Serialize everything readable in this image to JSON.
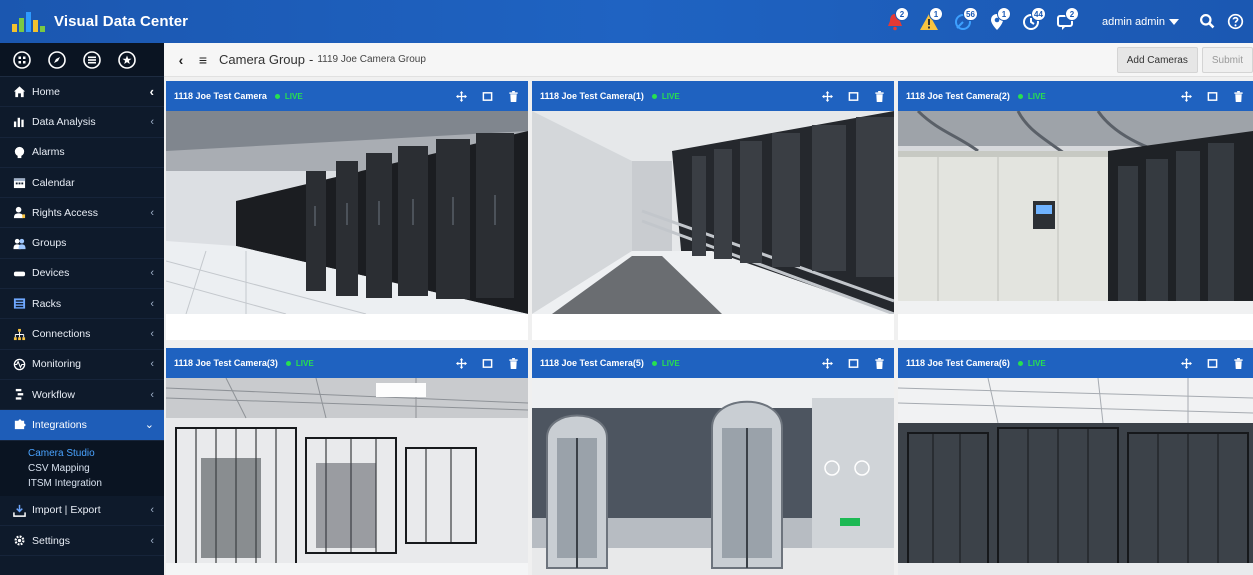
{
  "app": {
    "title": "Visual Data Center"
  },
  "brand": {
    "logo_colors": [
      "#f2c12e",
      "#7ac943",
      "#2e9bff",
      "#f2c12e",
      "#7ac943"
    ]
  },
  "colors": {
    "topbar": "#1f62c0",
    "sidebar": "#0e1a2b",
    "active_nav": "#1e5db8",
    "live": "#27e050",
    "link": "#4aa3ff"
  },
  "notifications": [
    {
      "icon": "alert-bell-icon",
      "count": "2",
      "color": "#e53935"
    },
    {
      "icon": "warning-icon",
      "count": "1",
      "color": "#f9c440"
    },
    {
      "icon": "satellite-icon",
      "count": "56",
      "color": "#3da0ff"
    },
    {
      "icon": "location-pin-icon",
      "count": "1",
      "color": "#ffffff"
    },
    {
      "icon": "refresh-clock-icon",
      "count": "44",
      "color": "#ffffff"
    },
    {
      "icon": "message-icon",
      "count": "2",
      "color": "#ffffff"
    }
  ],
  "user": {
    "name": "admin admin"
  },
  "sidebar": {
    "tabs": [
      "apps-icon",
      "compass-icon",
      "list-icon",
      "star-icon"
    ],
    "items": [
      {
        "label": "Home",
        "icon": "home-icon",
        "chevron": "‹"
      },
      {
        "label": "Data Analysis",
        "icon": "bar-chart-icon",
        "chevron": "‹"
      },
      {
        "label": "Alarms",
        "icon": "alarm-icon",
        "chevron": ""
      },
      {
        "label": "Calendar",
        "icon": "calendar-icon",
        "chevron": ""
      },
      {
        "label": "Rights Access",
        "icon": "user-key-icon",
        "chevron": "‹"
      },
      {
        "label": "Groups",
        "icon": "users-icon",
        "chevron": ""
      },
      {
        "label": "Devices",
        "icon": "device-icon",
        "chevron": "‹"
      },
      {
        "label": "Racks",
        "icon": "rack-icon",
        "chevron": "‹"
      },
      {
        "label": "Connections",
        "icon": "network-icon",
        "chevron": "‹"
      },
      {
        "label": "Monitoring",
        "icon": "monitor-icon",
        "chevron": "‹"
      },
      {
        "label": "Workflow",
        "icon": "workflow-icon",
        "chevron": "‹"
      },
      {
        "label": "Integrations",
        "icon": "puzzle-icon",
        "chevron": "⌄"
      }
    ],
    "subitems": [
      "Camera Studio",
      "CSV Mapping",
      "ITSM Integration"
    ],
    "bottom_items": [
      {
        "label": "Import | Export",
        "icon": "import-export-icon",
        "chevron": "‹"
      },
      {
        "label": "Settings",
        "icon": "settings-icon",
        "chevron": "‹"
      }
    ]
  },
  "header": {
    "title": "Camera Group",
    "separator": "-",
    "subtitle": "1119 Joe Camera Group",
    "add_cameras": "Add Cameras",
    "submit": "Submit"
  },
  "cameras": [
    {
      "title": "1118 Joe Test Camera",
      "status": "LIVE",
      "scene": "rows"
    },
    {
      "title": "1118 Joe Test Camera(1)",
      "status": "LIVE",
      "scene": "corridor"
    },
    {
      "title": "1118 Joe Test Camera(2)",
      "status": "LIVE",
      "scene": "ups"
    },
    {
      "title": "1118 Joe Test Camera(3)",
      "status": "LIVE",
      "scene": "cage"
    },
    {
      "title": "1118 Joe Test Camera(5)",
      "status": "LIVE",
      "scene": "turnstile"
    },
    {
      "title": "1118 Joe Test Camera(6)",
      "status": "LIVE",
      "scene": "cage2"
    }
  ]
}
